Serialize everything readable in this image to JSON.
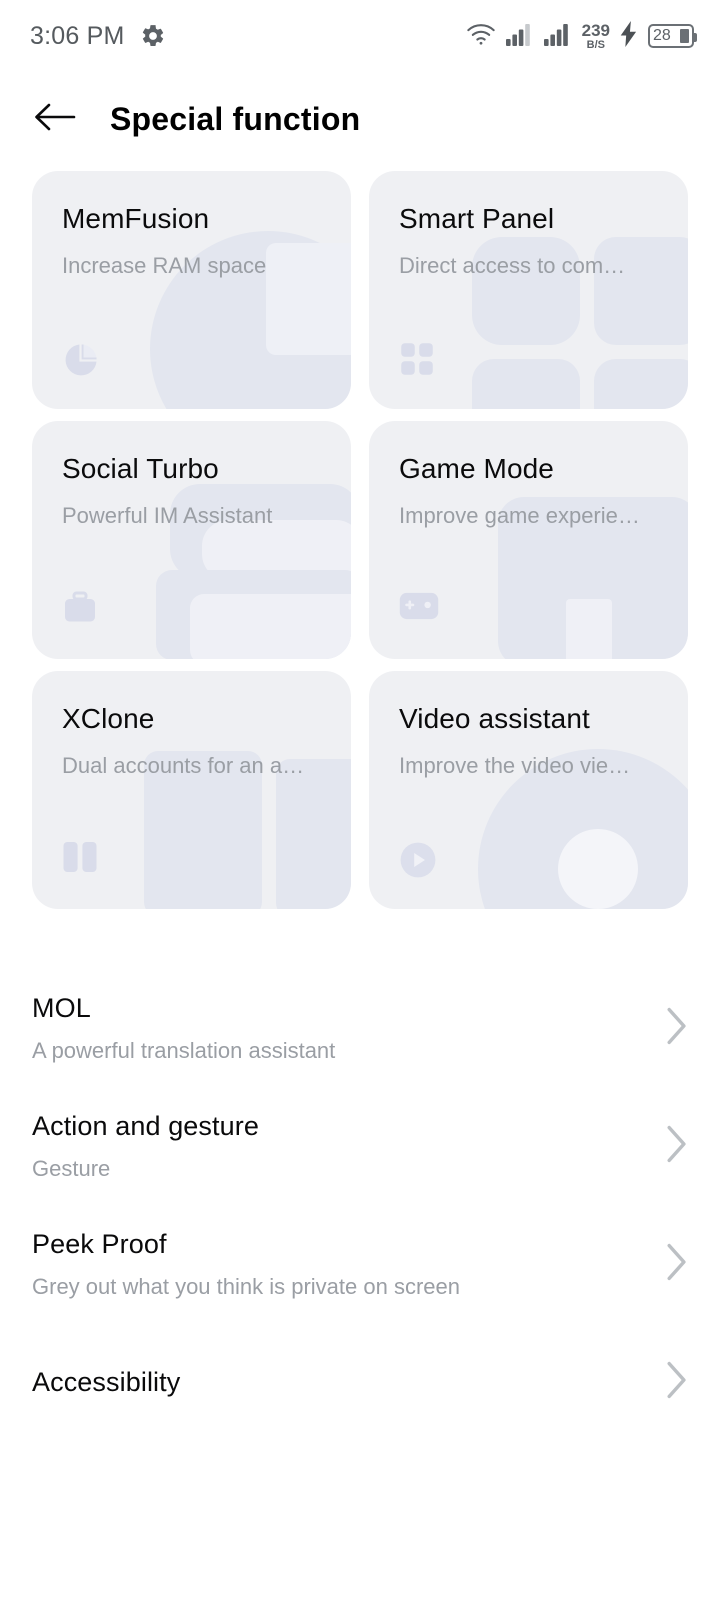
{
  "status_bar": {
    "time": "3:06 PM",
    "settings_icon": "gear-icon",
    "wifi_icon": "wifi-icon",
    "signal_icon_1": "signal-bars-icon",
    "signal_icon_2": "signal-bars-icon",
    "net_speed_value": "239",
    "net_speed_unit": "B/S",
    "charging_icon": "lightning-bolt-icon",
    "battery_level": "28"
  },
  "header": {
    "back_icon": "back-arrow-icon",
    "title": "Special function"
  },
  "cards": [
    {
      "title": "MemFusion",
      "subtitle": "Increase RAM space",
      "icon": "pie-chart-icon",
      "decoration": "circle-square-decoration"
    },
    {
      "title": "Smart Panel",
      "subtitle": "Direct access to com…",
      "icon": "four-squares-grid-icon",
      "decoration": "quad-grid-decoration"
    },
    {
      "title": "Social Turbo",
      "subtitle": "Powerful IM Assistant",
      "icon": "briefcase-icon",
      "decoration": "stacked-cards-decoration"
    },
    {
      "title": "Game Mode",
      "subtitle": "Improve game experie…",
      "icon": "gamepad-icon",
      "decoration": "rounded-block-decoration"
    },
    {
      "title": "XClone",
      "subtitle": "Dual accounts for an a…",
      "icon": "split-columns-icon",
      "decoration": "dual-panels-decoration"
    },
    {
      "title": "Video assistant",
      "subtitle": "Improve the video vie…",
      "icon": "play-circle-icon",
      "decoration": "disc-decoration"
    }
  ],
  "list_items": [
    {
      "title": "MOL",
      "subtitle": "A powerful translation assistant",
      "chevron": "chevron-right-icon"
    },
    {
      "title": "Action and gesture",
      "subtitle": "Gesture",
      "chevron": "chevron-right-icon"
    },
    {
      "title": "Peek Proof",
      "subtitle": "Grey out what you think is private on screen",
      "chevron": "chevron-right-icon"
    },
    {
      "title": "Accessibility",
      "subtitle": "",
      "chevron": "chevron-right-icon"
    }
  ],
  "colors": {
    "card_bg": "#eff0f3",
    "decoration": "#e2e5ee",
    "title_text": "#0a0a0b",
    "sub_text": "#9a9ea4",
    "page_bg": "#ffffff"
  }
}
